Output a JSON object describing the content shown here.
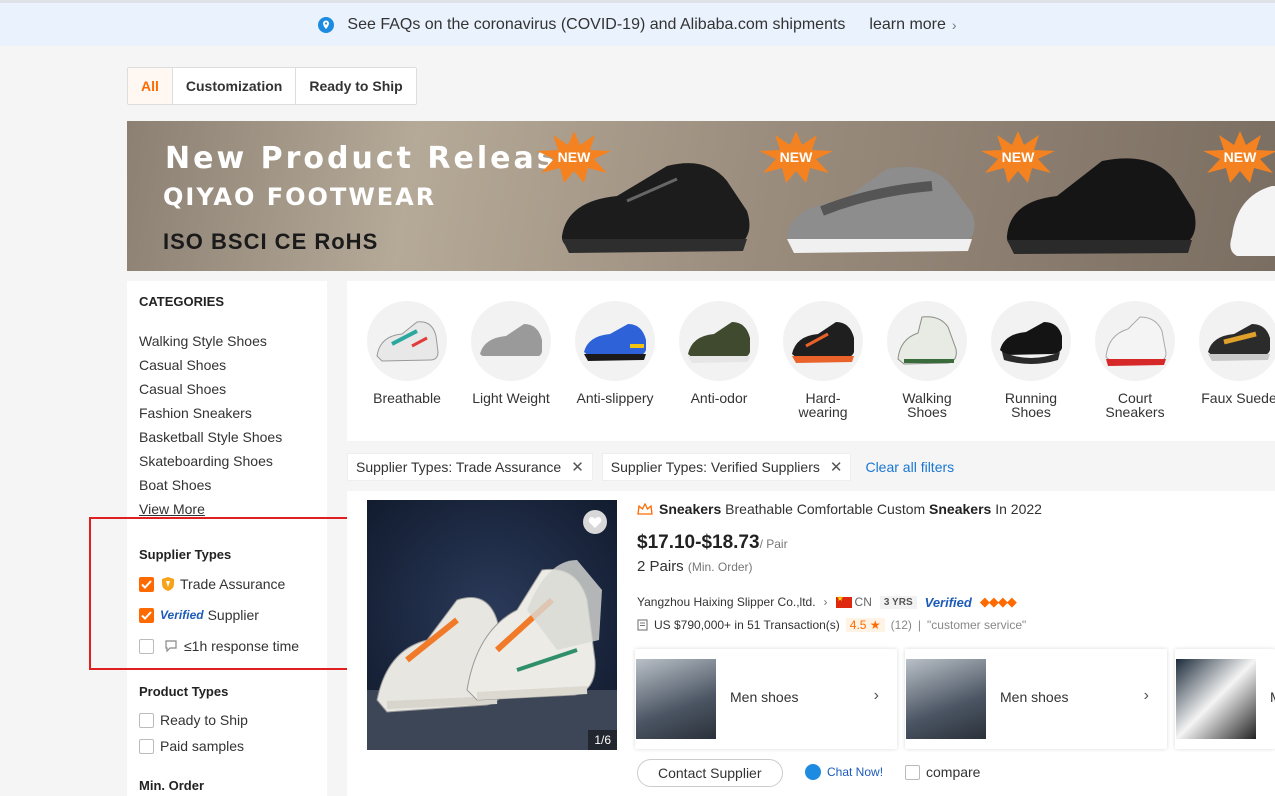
{
  "notice": {
    "text": "See FAQs on the coronavirus (COVID-19) and Alibaba.com shipments",
    "link": "learn more"
  },
  "tabs": [
    {
      "label": "All",
      "active": true
    },
    {
      "label": "Customization",
      "active": false
    },
    {
      "label": "Ready to Ship",
      "active": false
    }
  ],
  "banner": {
    "line1": "New Product Release",
    "line2": "QIYAO FOOTWEAR",
    "certs": "ISO  BSCI  CE RoHS",
    "badge": "NEW"
  },
  "sidebar": {
    "categories_title": "CATEGORIES",
    "categories": [
      "Walking Style Shoes",
      "Casual Shoes",
      "Casual Shoes",
      "Fashion Sneakers",
      "Basketball Style Shoes",
      "Skateboarding Shoes",
      "Boat Shoes"
    ],
    "view_more": "View More",
    "supplier_types_title": "Supplier Types",
    "trade_assurance": "Trade Assurance",
    "verified_badge": "Verified",
    "verified_supplier": "Supplier",
    "response_time": "≤1h response time",
    "product_types_title": "Product Types",
    "ready_to_ship": "Ready to Ship",
    "paid_samples": "Paid samples",
    "min_order_title": "Min. Order"
  },
  "category_strip": [
    {
      "label": "Breathable"
    },
    {
      "label": "Light Weight"
    },
    {
      "label": "Anti-slippery"
    },
    {
      "label": "Anti-odor"
    },
    {
      "label": "Hard-\nwearing"
    },
    {
      "label": "Walking\nShoes"
    },
    {
      "label": "Running\nShoes"
    },
    {
      "label": "Court\nSneakers"
    },
    {
      "label": "Faux Suede"
    }
  ],
  "filters": {
    "chip1": "Supplier Types: Trade Assurance",
    "chip2": "Supplier Types: Verified Suppliers",
    "clear": "Clear all filters"
  },
  "product": {
    "title_b1": "Sneakers",
    "title_mid": " Breathable Comfortable Custom ",
    "title_b2": "Sneakers",
    "title_end": " In 2022",
    "price": "$17.10-$18.73",
    "price_unit": "/ Pair",
    "moq": "2 Pairs",
    "moq_sub": "(Min. Order)",
    "supplier": "Yangzhou Haixing Slipper Co.,ltd.",
    "country": "CN",
    "years": "3 YRS",
    "verified": "Verified",
    "transactions": "US $790,000+ in 51 Transaction(s)",
    "rating": "4.5",
    "reviews": "(12)",
    "review_tag": "\"customer service\"",
    "image_counter": "1/6",
    "related": [
      {
        "label": "Men shoes"
      },
      {
        "label": "Men shoes"
      },
      {
        "label": "M"
      }
    ],
    "contact": "Contact Supplier",
    "chat": "Chat Now!",
    "compare": "compare"
  }
}
